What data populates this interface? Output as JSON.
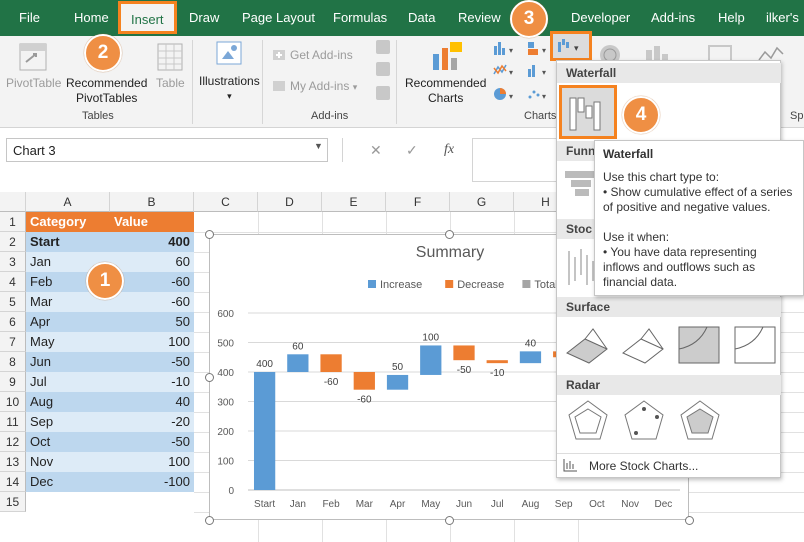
{
  "tabs": [
    {
      "label": "File"
    },
    {
      "label": "Home"
    },
    {
      "label": "Insert"
    },
    {
      "label": "Draw"
    },
    {
      "label": "Page Layout"
    },
    {
      "label": "Formulas"
    },
    {
      "label": "Data"
    },
    {
      "label": "Review"
    },
    {
      "label": "Developer"
    },
    {
      "label": "Add-ins"
    },
    {
      "label": "Help"
    },
    {
      "label": "ilker's"
    }
  ],
  "ribbon": {
    "pivot": "PivotTable",
    "rec_pivot_1": "Recommended",
    "rec_pivot_2": "PivotTables",
    "table": "Table",
    "group_tables": "Tables",
    "illustrations": "Illustrations",
    "get_addins": "Get Add-ins",
    "my_addins": "My Add-ins",
    "group_addins": "Add-ins",
    "rec_charts_1": "Recommended",
    "rec_charts_2": "Charts",
    "group_charts": "Charts",
    "sp": "Sp"
  },
  "badges": [
    "1",
    "2",
    "3",
    "4"
  ],
  "formula": {
    "name_box": "Chart 3",
    "fx": "fx",
    "cancel": "✕",
    "enter": "✓"
  },
  "columns": [
    "A",
    "B",
    "C",
    "D",
    "E",
    "F",
    "G",
    "H"
  ],
  "rows": [
    "1",
    "2",
    "3",
    "4",
    "5",
    "6",
    "7",
    "8",
    "9",
    "10",
    "11",
    "12",
    "13",
    "14",
    "15"
  ],
  "sheet": {
    "header": [
      "Category",
      "Value"
    ],
    "data": [
      [
        "Start",
        "400"
      ],
      [
        "Jan",
        "60"
      ],
      [
        "Feb",
        "-60"
      ],
      [
        "Mar",
        "-60"
      ],
      [
        "Apr",
        "50"
      ],
      [
        "May",
        "100"
      ],
      [
        "Jun",
        "-50"
      ],
      [
        "Jul",
        "-10"
      ],
      [
        "Aug",
        "40"
      ],
      [
        "Sep",
        "-20"
      ],
      [
        "Oct",
        "-50"
      ],
      [
        "Nov",
        "100"
      ],
      [
        "Dec",
        "-100"
      ]
    ],
    "header_color": "#ed7d31",
    "band_dark": "#bdd7ee",
    "band_light": "#ddebf7"
  },
  "chart_data": {
    "type": "bar",
    "subtype": "waterfall",
    "title": "Summary",
    "categories": [
      "Start",
      "Jan",
      "Feb",
      "Mar",
      "Apr",
      "May",
      "Jun",
      "Jul",
      "Aug",
      "Sep",
      "Oct",
      "Nov",
      "Dec"
    ],
    "values": [
      400,
      60,
      -60,
      -60,
      50,
      100,
      -50,
      -10,
      40,
      -20,
      -50,
      100,
      -100
    ],
    "data_labels": [
      "400",
      "60",
      "-60",
      "-60",
      "50",
      "100",
      "-50",
      "-10",
      "40"
    ],
    "legend": [
      {
        "name": "Increase",
        "color": "#5b9bd5"
      },
      {
        "name": "Decrease",
        "color": "#ed7d31"
      },
      {
        "name": "Total",
        "color": "#a5a5a5"
      }
    ],
    "legend_position": "top",
    "ylim": [
      0,
      600
    ],
    "yticks": [
      "0",
      "100",
      "200",
      "300",
      "400",
      "500",
      "600"
    ],
    "grid": true
  },
  "menu": {
    "waterfall": "Waterfall",
    "funnel": "Funn",
    "stock": "Stoc",
    "surface": "Surface",
    "radar": "Radar",
    "more": "More Stock Charts..."
  },
  "tooltip": {
    "title": "Waterfall",
    "line1": "Use this chart type to:",
    "line2": "• Show cumulative effect of a series",
    "line3": "of positive and negative values.",
    "line4": "Use it when:",
    "line5": "• You have data representing",
    "line6": "inflows and outflows such as",
    "line7": "financial data."
  },
  "colors": {
    "excel_green": "#217346",
    "highlight": "#f5821f",
    "badge": "#ef8f44"
  }
}
